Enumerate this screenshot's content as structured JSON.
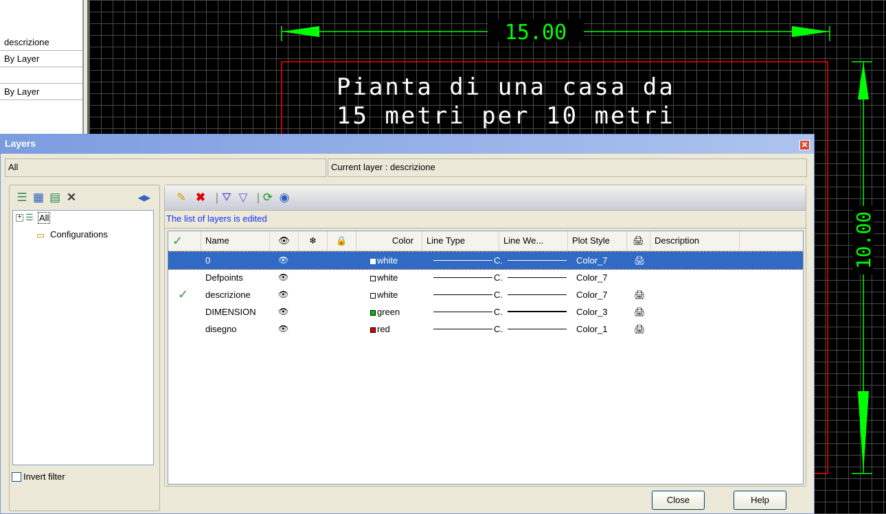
{
  "properties_panel": {
    "rows": [
      "descrizione",
      "By Layer",
      "",
      "By Layer"
    ]
  },
  "drawing": {
    "dimension_top": "15.00",
    "dimension_right": "10.00",
    "title_line1": "Pianta di una casa da",
    "title_line2": "15 metri per 10 metri"
  },
  "dialog": {
    "title": "Layers",
    "filter_label": "All",
    "current_layer": "Current layer : descrizione",
    "status": "The list of layers is edited",
    "tree": {
      "root": "All",
      "child": "Configurations"
    },
    "invert_filter": "Invert filter",
    "close_button": "Close",
    "help_button": "Help"
  },
  "columns": [
    "Name",
    "Color",
    "Line Type",
    "Line We...",
    "Plot Style",
    "Description"
  ],
  "layers": [
    {
      "current": false,
      "name": "0",
      "color_name": "white",
      "color": "#ffffff",
      "linetype": "C.",
      "plot_style": "Color_7",
      "plot": true,
      "selected": true
    },
    {
      "current": false,
      "name": "Defpoints",
      "color_name": "white",
      "color": "#ffffff",
      "linetype": "C.",
      "plot_style": "Color_7",
      "plot": false,
      "selected": false
    },
    {
      "current": true,
      "name": "descrizione",
      "color_name": "white",
      "color": "#ffffff",
      "linetype": "C.",
      "plot_style": "Color_7",
      "plot": true,
      "selected": false
    },
    {
      "current": false,
      "name": "DIMENSION",
      "color_name": "green",
      "color": "#00c000",
      "linetype": "C.",
      "plot_style": "Color_3",
      "plot": true,
      "selected": false,
      "thick": true
    },
    {
      "current": false,
      "name": "disegno",
      "color_name": "red",
      "color": "#e00000",
      "linetype": "C.",
      "plot_style": "Color_1",
      "plot": true,
      "selected": false
    }
  ],
  "colors": {
    "cad_green": "#00ff00",
    "cad_red": "#ff0000",
    "cad_text": "#ffffff",
    "selection": "#316ac5"
  }
}
